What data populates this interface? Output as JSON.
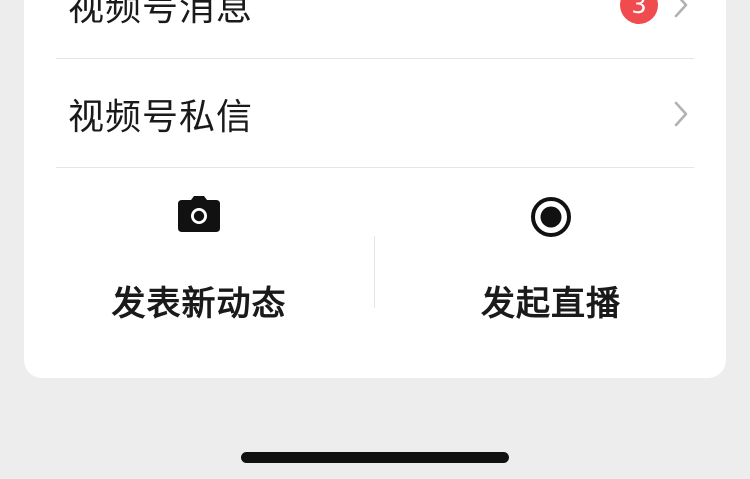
{
  "rows": [
    {
      "label": "视频号消息",
      "badge": "3"
    },
    {
      "label": "视频号私信"
    }
  ],
  "actions": [
    {
      "label": "发表新动态",
      "icon": "camera-icon"
    },
    {
      "label": "发起直播",
      "icon": "live-record-icon"
    }
  ],
  "colors": {
    "background": "#ededed",
    "card": "#ffffff",
    "badge": "#f04c4f",
    "text": "#1a1a1a",
    "divider": "#e5e5e5",
    "chevron": "#b2b2b2"
  }
}
